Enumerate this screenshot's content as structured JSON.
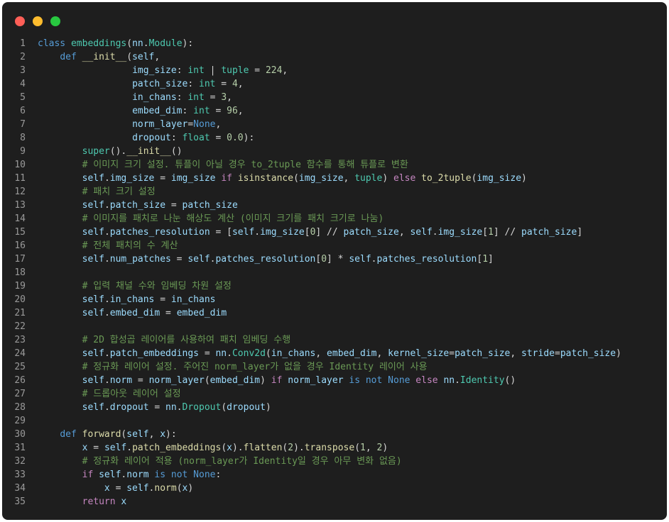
{
  "window": {
    "title_buttons": [
      "close",
      "minimize",
      "maximize"
    ],
    "colors": {
      "close": "#ff5f57",
      "minimize": "#febc2e",
      "maximize": "#28c840",
      "background": "#1e1e1e"
    }
  },
  "code": {
    "language": "python",
    "lines": [
      {
        "n": "1",
        "tokens": [
          [
            "kw",
            "class "
          ],
          [
            "cls",
            "embeddings"
          ],
          [
            "t",
            "("
          ],
          [
            "pm",
            "nn"
          ],
          [
            "t",
            "."
          ],
          [
            "cls",
            "Module"
          ],
          [
            "t",
            "):"
          ]
        ]
      },
      {
        "n": "2",
        "tokens": [
          [
            "t",
            "    "
          ],
          [
            "kw",
            "def "
          ],
          [
            "fn",
            "__init__"
          ],
          [
            "t",
            "("
          ],
          [
            "pm",
            "self"
          ],
          [
            "t",
            ","
          ]
        ]
      },
      {
        "n": "3",
        "tokens": [
          [
            "t",
            "                 "
          ],
          [
            "pm",
            "img_size"
          ],
          [
            "t",
            ": "
          ],
          [
            "cls",
            "int"
          ],
          [
            "t",
            " | "
          ],
          [
            "cls",
            "tuple"
          ],
          [
            "t",
            " = "
          ],
          [
            "num",
            "224"
          ],
          [
            "t",
            ","
          ]
        ]
      },
      {
        "n": "4",
        "tokens": [
          [
            "t",
            "                 "
          ],
          [
            "pm",
            "patch_size"
          ],
          [
            "t",
            ": "
          ],
          [
            "cls",
            "int"
          ],
          [
            "t",
            " = "
          ],
          [
            "num",
            "4"
          ],
          [
            "t",
            ","
          ]
        ]
      },
      {
        "n": "5",
        "tokens": [
          [
            "t",
            "                 "
          ],
          [
            "pm",
            "in_chans"
          ],
          [
            "t",
            ": "
          ],
          [
            "cls",
            "int"
          ],
          [
            "t",
            " = "
          ],
          [
            "num",
            "3"
          ],
          [
            "t",
            ","
          ]
        ]
      },
      {
        "n": "6",
        "tokens": [
          [
            "t",
            "                 "
          ],
          [
            "pm",
            "embed_dim"
          ],
          [
            "t",
            ": "
          ],
          [
            "cls",
            "int"
          ],
          [
            "t",
            " = "
          ],
          [
            "num",
            "96"
          ],
          [
            "t",
            ","
          ]
        ]
      },
      {
        "n": "7",
        "tokens": [
          [
            "t",
            "                 "
          ],
          [
            "pm",
            "norm_layer"
          ],
          [
            "t",
            "="
          ],
          [
            "kw",
            "None"
          ],
          [
            "t",
            ","
          ]
        ]
      },
      {
        "n": "8",
        "tokens": [
          [
            "t",
            "                 "
          ],
          [
            "pm",
            "dropout"
          ],
          [
            "t",
            ": "
          ],
          [
            "cls",
            "float"
          ],
          [
            "t",
            " = "
          ],
          [
            "num",
            "0.0"
          ],
          [
            "t",
            "):"
          ]
        ]
      },
      {
        "n": "9",
        "tokens": [
          [
            "t",
            "        "
          ],
          [
            "cls",
            "super"
          ],
          [
            "t",
            "()."
          ],
          [
            "fn",
            "__init__"
          ],
          [
            "t",
            "()"
          ]
        ]
      },
      {
        "n": "10",
        "tokens": [
          [
            "t",
            "        "
          ],
          [
            "cm",
            "# 이미지 크기 설정. 튜플이 아닐 경우 to_2tuple 함수를 통해 튜플로 변환"
          ]
        ]
      },
      {
        "n": "11",
        "tokens": [
          [
            "t",
            "        "
          ],
          [
            "pm",
            "self"
          ],
          [
            "t",
            "."
          ],
          [
            "pm",
            "img_size"
          ],
          [
            "t",
            " = "
          ],
          [
            "pm",
            "img_size"
          ],
          [
            "t",
            " "
          ],
          [
            "ctl",
            "if"
          ],
          [
            "t",
            " "
          ],
          [
            "fn",
            "isinstance"
          ],
          [
            "t",
            "("
          ],
          [
            "pm",
            "img_size"
          ],
          [
            "t",
            ", "
          ],
          [
            "cls",
            "tuple"
          ],
          [
            "t",
            ") "
          ],
          [
            "ctl",
            "else"
          ],
          [
            "t",
            " "
          ],
          [
            "fn",
            "to_2tuple"
          ],
          [
            "t",
            "("
          ],
          [
            "pm",
            "img_size"
          ],
          [
            "t",
            ")"
          ]
        ]
      },
      {
        "n": "12",
        "tokens": [
          [
            "t",
            "        "
          ],
          [
            "cm",
            "# 패치 크기 설정"
          ]
        ]
      },
      {
        "n": "13",
        "tokens": [
          [
            "t",
            "        "
          ],
          [
            "pm",
            "self"
          ],
          [
            "t",
            "."
          ],
          [
            "pm",
            "patch_size"
          ],
          [
            "t",
            " = "
          ],
          [
            "pm",
            "patch_size"
          ]
        ]
      },
      {
        "n": "14",
        "tokens": [
          [
            "t",
            "        "
          ],
          [
            "cm",
            "# 이미지를 패치로 나눈 해상도 계산 (이미지 크기를 패치 크기로 나눔)"
          ]
        ]
      },
      {
        "n": "15",
        "tokens": [
          [
            "t",
            "        "
          ],
          [
            "pm",
            "self"
          ],
          [
            "t",
            "."
          ],
          [
            "pm",
            "patches_resolution"
          ],
          [
            "t",
            " = ["
          ],
          [
            "pm",
            "self"
          ],
          [
            "t",
            "."
          ],
          [
            "pm",
            "img_size"
          ],
          [
            "t",
            "["
          ],
          [
            "num",
            "0"
          ],
          [
            "t",
            "] // "
          ],
          [
            "pm",
            "patch_size"
          ],
          [
            "t",
            ", "
          ],
          [
            "pm",
            "self"
          ],
          [
            "t",
            "."
          ],
          [
            "pm",
            "img_size"
          ],
          [
            "t",
            "["
          ],
          [
            "num",
            "1"
          ],
          [
            "t",
            "] // "
          ],
          [
            "pm",
            "patch_size"
          ],
          [
            "t",
            "]"
          ]
        ]
      },
      {
        "n": "16",
        "tokens": [
          [
            "t",
            "        "
          ],
          [
            "cm",
            "# 전체 패치의 수 계산"
          ]
        ]
      },
      {
        "n": "17",
        "tokens": [
          [
            "t",
            "        "
          ],
          [
            "pm",
            "self"
          ],
          [
            "t",
            "."
          ],
          [
            "pm",
            "num_patches"
          ],
          [
            "t",
            " = "
          ],
          [
            "pm",
            "self"
          ],
          [
            "t",
            "."
          ],
          [
            "pm",
            "patches_resolution"
          ],
          [
            "t",
            "["
          ],
          [
            "num",
            "0"
          ],
          [
            "t",
            "] * "
          ],
          [
            "pm",
            "self"
          ],
          [
            "t",
            "."
          ],
          [
            "pm",
            "patches_resolution"
          ],
          [
            "t",
            "["
          ],
          [
            "num",
            "1"
          ],
          [
            "t",
            "]"
          ]
        ]
      },
      {
        "n": "18",
        "tokens": []
      },
      {
        "n": "19",
        "tokens": [
          [
            "t",
            "        "
          ],
          [
            "cm",
            "# 입력 채널 수와 임베딩 차원 설정"
          ]
        ]
      },
      {
        "n": "20",
        "tokens": [
          [
            "t",
            "        "
          ],
          [
            "pm",
            "self"
          ],
          [
            "t",
            "."
          ],
          [
            "pm",
            "in_chans"
          ],
          [
            "t",
            " = "
          ],
          [
            "pm",
            "in_chans"
          ]
        ]
      },
      {
        "n": "21",
        "tokens": [
          [
            "t",
            "        "
          ],
          [
            "pm",
            "self"
          ],
          [
            "t",
            "."
          ],
          [
            "pm",
            "embed_dim"
          ],
          [
            "t",
            " = "
          ],
          [
            "pm",
            "embed_dim"
          ]
        ]
      },
      {
        "n": "22",
        "tokens": []
      },
      {
        "n": "23",
        "tokens": [
          [
            "t",
            "        "
          ],
          [
            "cm",
            "# 2D 합성곱 레이어를 사용하여 패치 임베딩 수행"
          ]
        ]
      },
      {
        "n": "24",
        "tokens": [
          [
            "t",
            "        "
          ],
          [
            "pm",
            "self"
          ],
          [
            "t",
            "."
          ],
          [
            "pm",
            "patch_embeddings"
          ],
          [
            "t",
            " = "
          ],
          [
            "pm",
            "nn"
          ],
          [
            "t",
            "."
          ],
          [
            "cls",
            "Conv2d"
          ],
          [
            "t",
            "("
          ],
          [
            "pm",
            "in_chans"
          ],
          [
            "t",
            ", "
          ],
          [
            "pm",
            "embed_dim"
          ],
          [
            "t",
            ", "
          ],
          [
            "pm",
            "kernel_size"
          ],
          [
            "t",
            "="
          ],
          [
            "pm",
            "patch_size"
          ],
          [
            "t",
            ", "
          ],
          [
            "pm",
            "stride"
          ],
          [
            "t",
            "="
          ],
          [
            "pm",
            "patch_size"
          ],
          [
            "t",
            ")"
          ]
        ]
      },
      {
        "n": "25",
        "tokens": [
          [
            "t",
            "        "
          ],
          [
            "cm",
            "# 정규화 레이어 설정. 주어진 norm_layer가 없을 경우 Identity 레이어 사용"
          ]
        ]
      },
      {
        "n": "26",
        "tokens": [
          [
            "t",
            "        "
          ],
          [
            "pm",
            "self"
          ],
          [
            "t",
            "."
          ],
          [
            "pm",
            "norm"
          ],
          [
            "t",
            " = "
          ],
          [
            "pm",
            "norm_layer"
          ],
          [
            "t",
            "("
          ],
          [
            "pm",
            "embed_dim"
          ],
          [
            "t",
            ") "
          ],
          [
            "ctl",
            "if"
          ],
          [
            "t",
            " "
          ],
          [
            "pm",
            "norm_layer"
          ],
          [
            "t",
            " "
          ],
          [
            "kw",
            "is not None"
          ],
          [
            "t",
            " "
          ],
          [
            "ctl",
            "else"
          ],
          [
            "t",
            " "
          ],
          [
            "pm",
            "nn"
          ],
          [
            "t",
            "."
          ],
          [
            "cls",
            "Identity"
          ],
          [
            "t",
            "()"
          ]
        ]
      },
      {
        "n": "27",
        "tokens": [
          [
            "t",
            "        "
          ],
          [
            "cm",
            "# 드롭아웃 레이어 설정"
          ]
        ]
      },
      {
        "n": "28",
        "tokens": [
          [
            "t",
            "        "
          ],
          [
            "pm",
            "self"
          ],
          [
            "t",
            "."
          ],
          [
            "pm",
            "dropout"
          ],
          [
            "t",
            " = "
          ],
          [
            "pm",
            "nn"
          ],
          [
            "t",
            "."
          ],
          [
            "cls",
            "Dropout"
          ],
          [
            "t",
            "("
          ],
          [
            "pm",
            "dropout"
          ],
          [
            "t",
            ")"
          ]
        ]
      },
      {
        "n": "29",
        "tokens": []
      },
      {
        "n": "30",
        "tokens": [
          [
            "t",
            "    "
          ],
          [
            "kw",
            "def "
          ],
          [
            "fn",
            "forward"
          ],
          [
            "t",
            "("
          ],
          [
            "pm",
            "self"
          ],
          [
            "t",
            ", "
          ],
          [
            "pm",
            "x"
          ],
          [
            "t",
            "):"
          ]
        ]
      },
      {
        "n": "31",
        "tokens": [
          [
            "t",
            "        "
          ],
          [
            "pm",
            "x"
          ],
          [
            "t",
            " = "
          ],
          [
            "pm",
            "self"
          ],
          [
            "t",
            "."
          ],
          [
            "fn",
            "patch_embeddings"
          ],
          [
            "t",
            "("
          ],
          [
            "pm",
            "x"
          ],
          [
            "t",
            ")."
          ],
          [
            "fn",
            "flatten"
          ],
          [
            "t",
            "("
          ],
          [
            "num",
            "2"
          ],
          [
            "t",
            ")."
          ],
          [
            "fn",
            "transpose"
          ],
          [
            "t",
            "("
          ],
          [
            "num",
            "1"
          ],
          [
            "t",
            ", "
          ],
          [
            "num",
            "2"
          ],
          [
            "t",
            ")"
          ]
        ]
      },
      {
        "n": "32",
        "tokens": [
          [
            "t",
            "        "
          ],
          [
            "cm",
            "# 정규화 레이어 적용 (norm_layer가 Identity일 경우 아무 변화 없음)"
          ]
        ]
      },
      {
        "n": "33",
        "tokens": [
          [
            "t",
            "        "
          ],
          [
            "ctl",
            "if"
          ],
          [
            "t",
            " "
          ],
          [
            "pm",
            "self"
          ],
          [
            "t",
            "."
          ],
          [
            "pm",
            "norm"
          ],
          [
            "t",
            " "
          ],
          [
            "kw",
            "is not None"
          ],
          [
            "t",
            ":"
          ]
        ]
      },
      {
        "n": "34",
        "tokens": [
          [
            "t",
            "            "
          ],
          [
            "pm",
            "x"
          ],
          [
            "t",
            " = "
          ],
          [
            "pm",
            "self"
          ],
          [
            "t",
            "."
          ],
          [
            "fn",
            "norm"
          ],
          [
            "t",
            "("
          ],
          [
            "pm",
            "x"
          ],
          [
            "t",
            ")"
          ]
        ]
      },
      {
        "n": "35",
        "tokens": [
          [
            "t",
            "        "
          ],
          [
            "ctl",
            "return"
          ],
          [
            "t",
            " "
          ],
          [
            "pm",
            "x"
          ]
        ]
      }
    ]
  }
}
